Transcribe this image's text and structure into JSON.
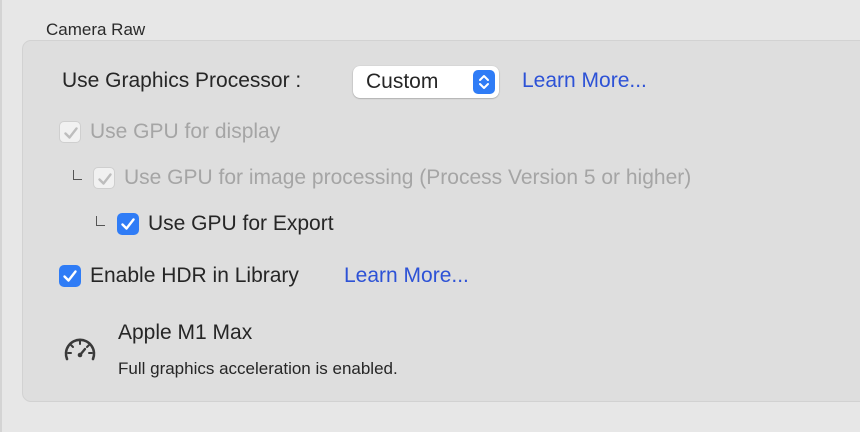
{
  "section_title": "Camera Raw",
  "graphics_processor": {
    "label": "Use Graphics Processor :",
    "selected": "Custom",
    "learn_more": "Learn More..."
  },
  "options": {
    "gpu_display": {
      "label": "Use GPU for display",
      "checked": true,
      "disabled": true
    },
    "gpu_image_processing": {
      "label": "Use GPU for image processing (Process Version 5 or higher)",
      "checked": true,
      "disabled": true
    },
    "gpu_export": {
      "label": "Use GPU for Export",
      "checked": true,
      "disabled": false
    },
    "hdr_library": {
      "label": "Enable HDR in Library",
      "checked": true,
      "disabled": false,
      "learn_more": "Learn More..."
    }
  },
  "gpu_info": {
    "icon": "gauge-icon",
    "name": "Apple M1 Max",
    "status": "Full graphics acceleration is enabled."
  },
  "colors": {
    "accent": "#2f7cf6",
    "link": "#2d52d6",
    "disabled_text": "#a5a5a5"
  }
}
